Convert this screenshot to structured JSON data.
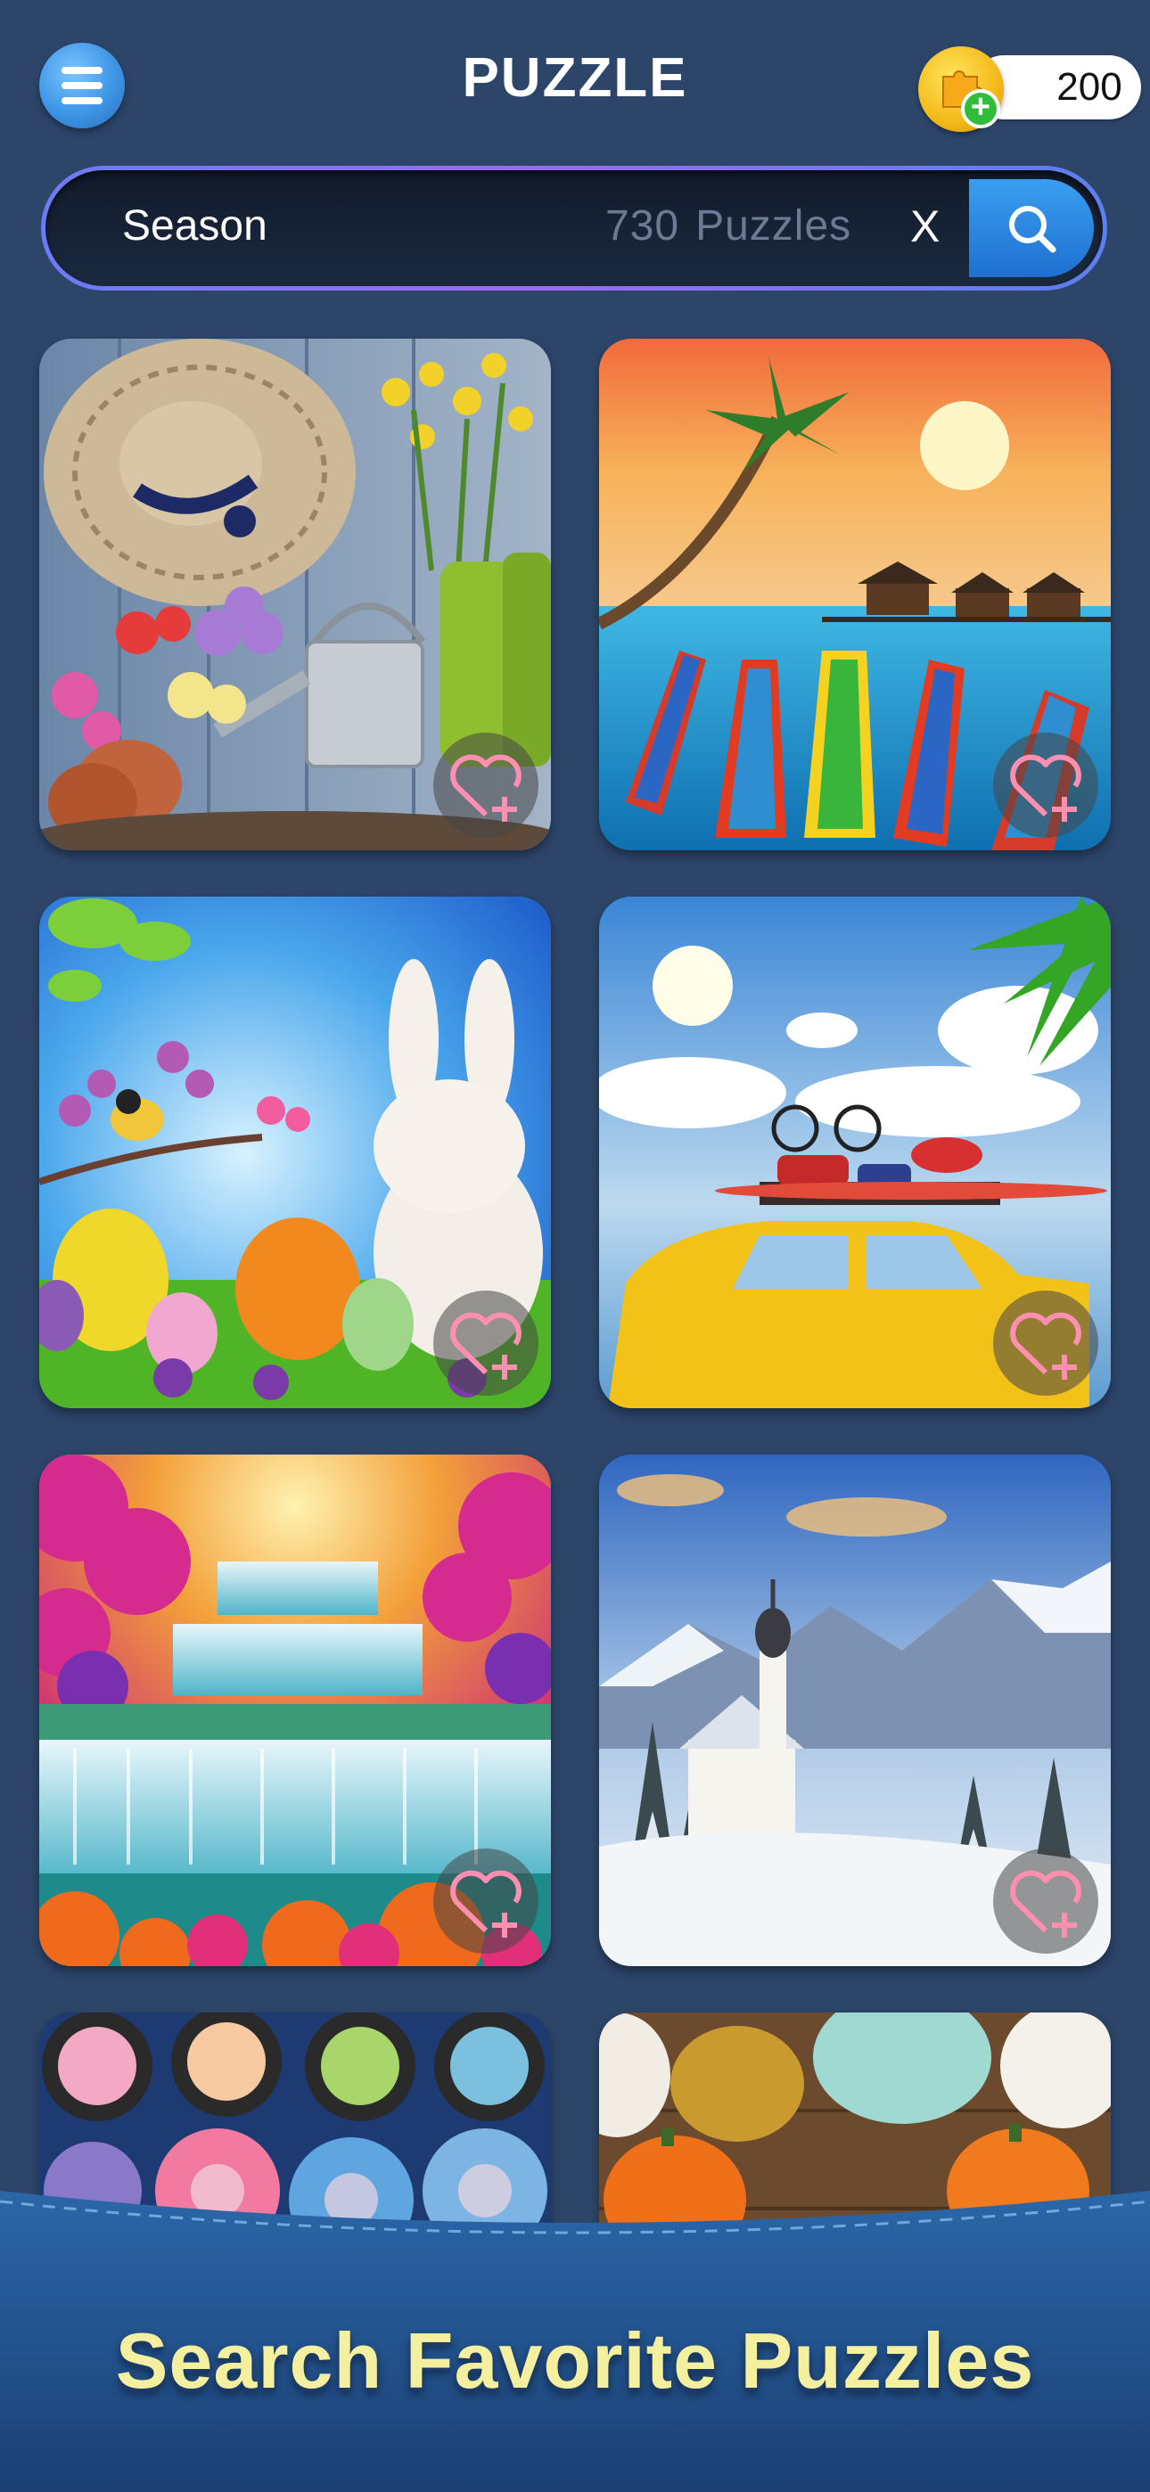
{
  "header": {
    "title": "PUZZLE",
    "coins": "200"
  },
  "search": {
    "query": "Season",
    "count": "730",
    "count_label": "Puzzles",
    "clear": "X"
  },
  "puzzles": [
    {
      "name": "garden-hat",
      "favorite_icon": "heart-plus-icon"
    },
    {
      "name": "tropical-boats",
      "favorite_icon": "heart-plus-icon"
    },
    {
      "name": "easter-bunny",
      "favorite_icon": "heart-plus-icon"
    },
    {
      "name": "yellow-car-beach",
      "favorite_icon": "heart-plus-icon"
    },
    {
      "name": "waterfall-forest",
      "favorite_icon": "heart-plus-icon"
    },
    {
      "name": "winter-church",
      "favorite_icon": "heart-plus-icon"
    },
    {
      "name": "succulents",
      "favorite_icon": "heart-plus-icon"
    },
    {
      "name": "pumpkins",
      "favorite_icon": "heart-plus-icon"
    }
  ],
  "footer": {
    "label": "Search Favorite Puzzles"
  },
  "colors": {
    "background": "#2c4569",
    "accent": "#3a9ff0",
    "footer_text": "#f5f0a0"
  }
}
